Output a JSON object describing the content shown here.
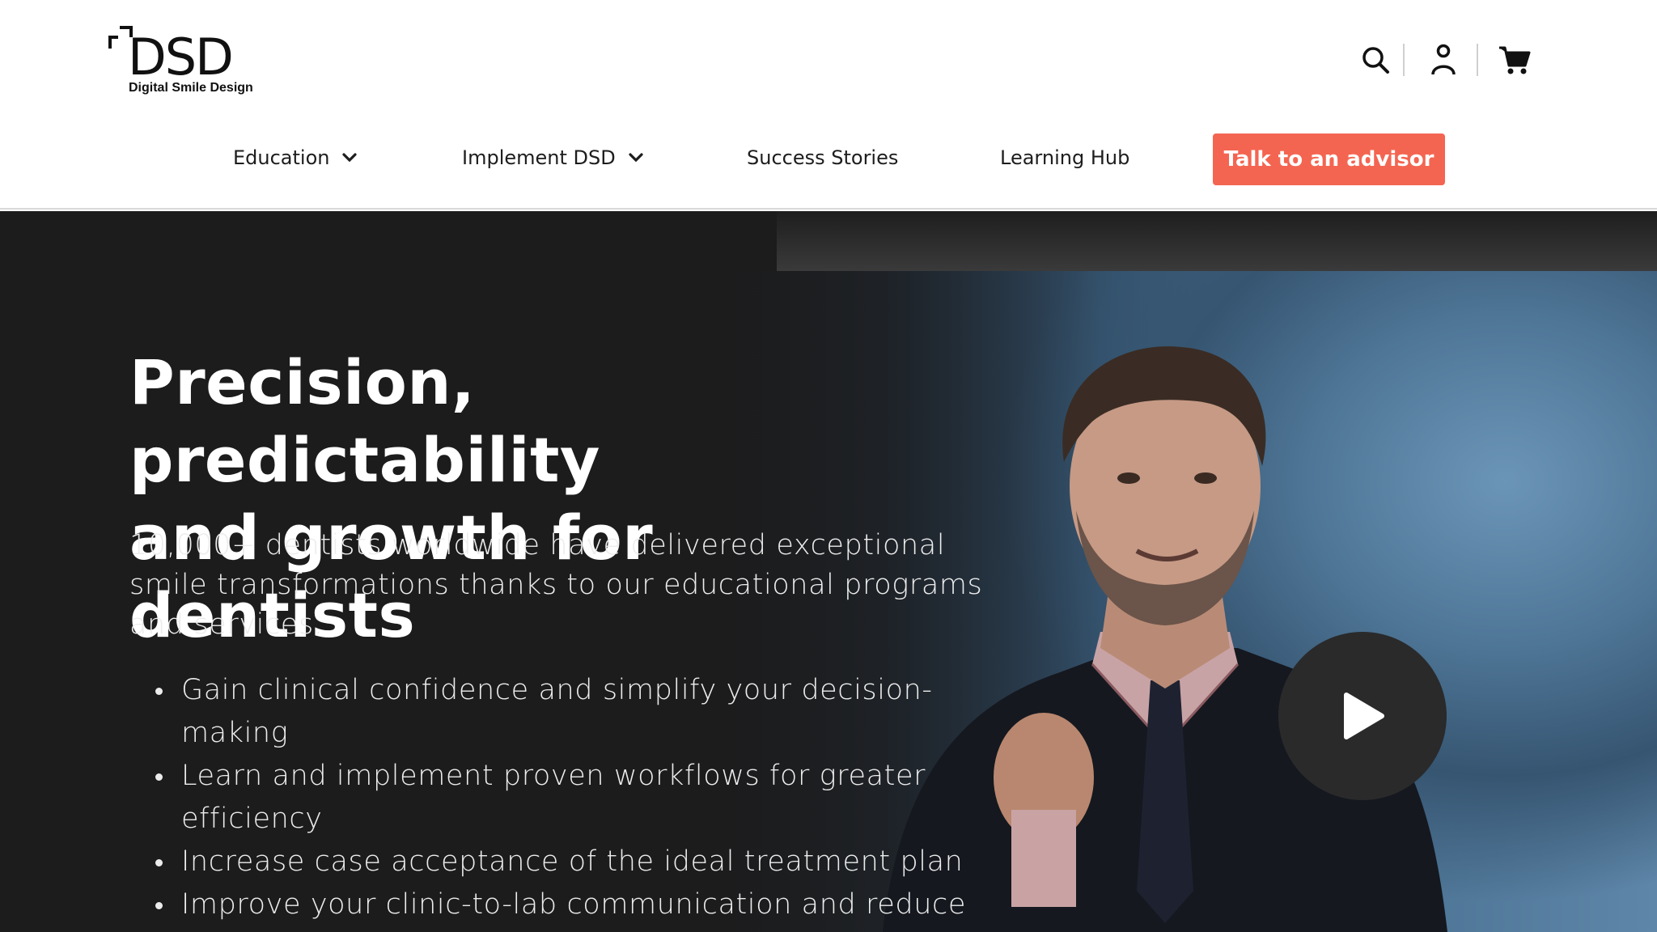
{
  "brand": {
    "name": "DSD",
    "tagline": "Digital Smile Design"
  },
  "utility": {
    "icons": [
      "search-icon",
      "user-icon",
      "cart-icon"
    ]
  },
  "nav": {
    "items": [
      {
        "label": "Education",
        "has_dropdown": true
      },
      {
        "label": "Implement DSD",
        "has_dropdown": true
      },
      {
        "label": "Success Stories",
        "has_dropdown": false
      },
      {
        "label": "Learning Hub",
        "has_dropdown": false
      }
    ],
    "cta_label": "Talk to an advisor"
  },
  "hero": {
    "title_line1": "Precision, predictability",
    "title_line2": "and growth for dentists",
    "intro_line1": "10,000+ dentists worldwide have delivered exceptional",
    "intro_line2": "smile transformations thanks to our educational programs",
    "intro_line3": "and services.",
    "bullets": [
      {
        "line1": "Gain clinical confidence and simplify your decision-",
        "line2": "making"
      },
      {
        "line1": "Learn and implement proven workflows for greater",
        "line2": "efficiency"
      },
      {
        "line1": "Increase case acceptance of the ideal treatment plan",
        "line2": ""
      },
      {
        "line1": "Improve your clinic-to-lab communication and reduce",
        "line2": ""
      }
    ]
  },
  "video": {
    "play_icon": "play-icon"
  },
  "colors": {
    "accent": "#f46551",
    "hero_bg": "#1c1c1d",
    "text_dark": "#1d1d1d",
    "text_light": "#ffffff"
  }
}
